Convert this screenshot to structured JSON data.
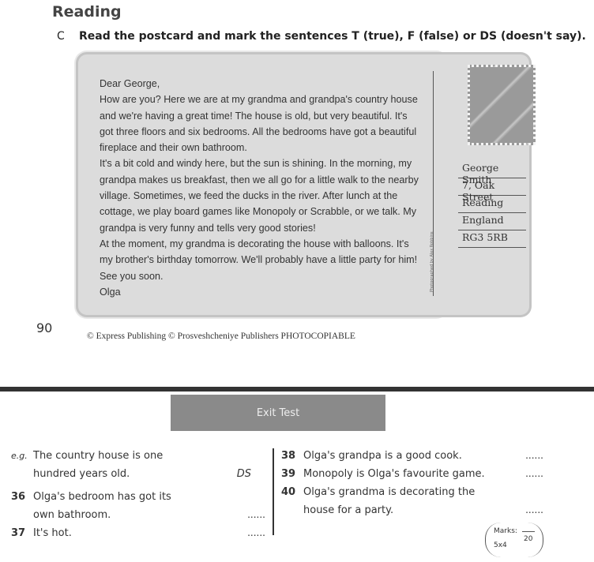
{
  "section_title": "Reading",
  "instruction": {
    "letter": "C",
    "text": "Read the postcard and mark the sentences T (true), F (false) or DS (doesn't say)."
  },
  "postcard": {
    "lines": [
      "Dear George,",
      "How are you? Here we are at my grandma and grandpa's country house",
      "and we're having a great time! The house is old, but very beautiful. It's",
      "got three floors and six bedrooms. All the bedrooms have got a beautiful",
      "fireplace and their own bathroom.",
      "It's a bit cold and windy here, but the sun is shining. In the morning, my",
      "grandpa makes us breakfast, then we all go for a little walk to the nearby",
      "village. Sometimes, we feed the ducks in the river. After lunch at the",
      "cottage, we play board games like Monopoly or Scrabble, or we talk. My",
      "grandpa is very funny and tells very good stories!",
      "At the moment, my grandma is decorating the house with balloons. It's",
      "my brother's birthday tomorrow. We'll probably have a little party for him!",
      "See you soon.",
      "Olga"
    ],
    "address": [
      "George Smith",
      "7, Oak Street",
      "Reading",
      "England",
      "RG3 5RB"
    ],
    "credit": "Photographed by Alex Robbins"
  },
  "page_number": "90",
  "copyright": "© Express Publishing © Prosveshcheniye Publishers PHOTOCOPIABLE",
  "exit_test": "Exit Test",
  "questions_left": [
    {
      "num": "e.g.",
      "lines": [
        "The country house is one",
        "hundred years old."
      ],
      "answer": "DS"
    },
    {
      "num": "36",
      "lines": [
        "Olga's bedroom has got its",
        "own bathroom."
      ],
      "answer": "......"
    },
    {
      "num": "37",
      "lines": [
        "It's hot."
      ],
      "answer": "......"
    }
  ],
  "questions_right": [
    {
      "num": "38",
      "lines": [
        "Olga's grandpa is a good cook."
      ],
      "answer": "......"
    },
    {
      "num": "39",
      "lines": [
        "Monopoly is Olga's favourite game."
      ],
      "answer": "......"
    },
    {
      "num": "40",
      "lines": [
        "Olga's grandma is decorating the",
        "house for a party."
      ],
      "answer": "......"
    }
  ],
  "marks": {
    "label": "Marks:",
    "formula": "5x4",
    "total": "20"
  }
}
